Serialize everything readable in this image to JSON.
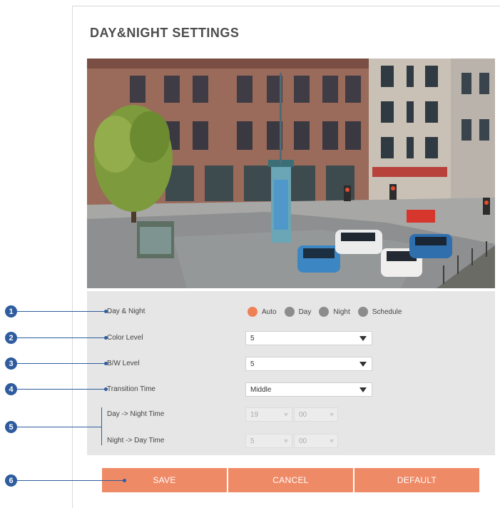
{
  "page": {
    "title": "DAY&NIGHT SETTINGS"
  },
  "preview": {
    "label": ""
  },
  "settings": {
    "day_night": {
      "label": "Day & Night",
      "options": [
        "Auto",
        "Day",
        "Night",
        "Schedule"
      ],
      "selected": "Auto"
    },
    "color_level": {
      "label": "Color Level",
      "value": "5"
    },
    "bw_level": {
      "label": "B/W Level",
      "value": "5"
    },
    "transition_time": {
      "label": "Transition Time",
      "value": "Middle"
    },
    "day_to_night": {
      "label": "Day -> Night Time",
      "hour": "19",
      "minute": "00"
    },
    "night_to_day": {
      "label": "Night -> Day Time",
      "hour": "5",
      "minute": "00"
    }
  },
  "buttons": {
    "save": "SAVE",
    "cancel": "CANCEL",
    "default": "DEFAULT"
  },
  "callouts": [
    "1",
    "2",
    "3",
    "4",
    "5",
    "6"
  ],
  "colors": {
    "accent": "#ef8a66",
    "selected_radio": "#ef7f55",
    "unselected_radio": "#8c8c8c",
    "callout": "#2e5c9e",
    "settings_bg": "#e6e6e6"
  }
}
